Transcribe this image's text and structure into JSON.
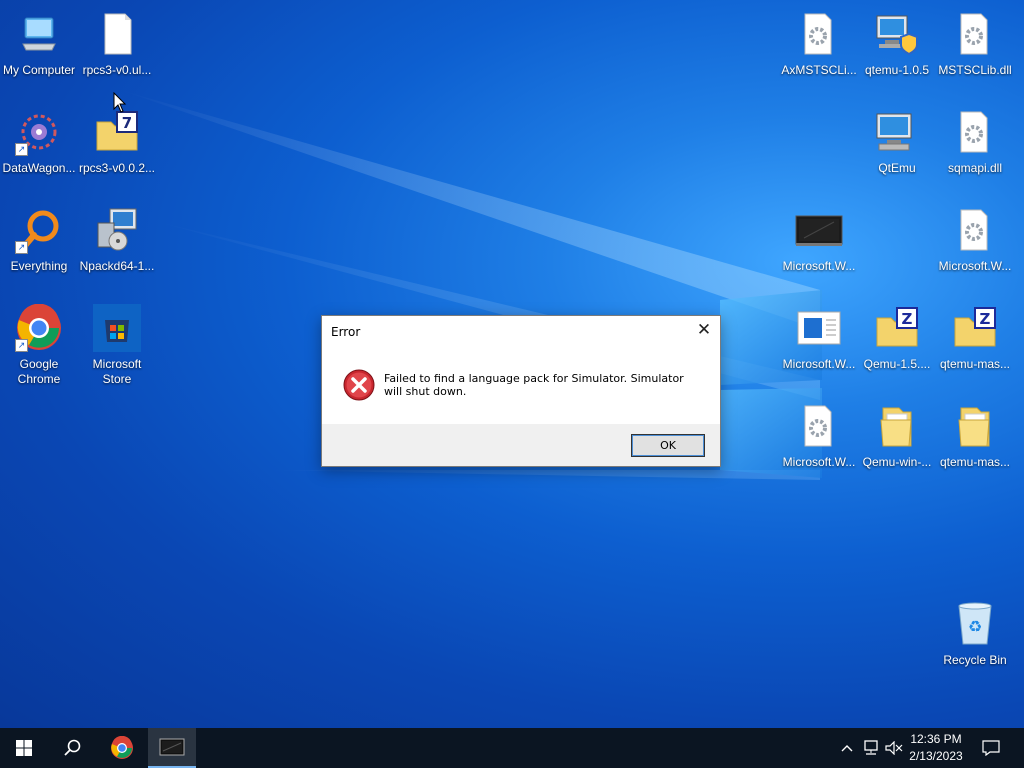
{
  "desktop": {
    "left_icons": [
      {
        "label": "My Computer",
        "icon": "computer-icon"
      },
      {
        "label": "rpcs3-v0.ul...",
        "icon": "file-icon"
      },
      {
        "label": "DataWagon...",
        "icon": "datawagon-icon"
      },
      {
        "label": "rpcs3-v0.0.2...",
        "icon": "archive-icon"
      },
      {
        "label": "Everything",
        "icon": "search-magnifier-icon"
      },
      {
        "label": "Npackd64-1...",
        "icon": "installer-icon"
      },
      {
        "label": "Google Chrome",
        "icon": "chrome-icon"
      },
      {
        "label": "Microsoft Store",
        "icon": "store-icon"
      }
    ],
    "right_icons": [
      {
        "label": "AxMSTSCLi...",
        "icon": "dll-icon"
      },
      {
        "label": "qtemu-1.0.5",
        "icon": "setup-icon"
      },
      {
        "label": "MSTSCLib.dll",
        "icon": "dll-icon"
      },
      {
        "label": "QtEmu",
        "icon": "computer-icon"
      },
      {
        "label": "sqmapi.dll",
        "icon": "dll-icon"
      },
      {
        "label": "Microsoft.W...",
        "icon": "monitor-icon"
      },
      {
        "label": "Microsoft.W...",
        "icon": "dll-icon"
      },
      {
        "label": "Microsoft.W...",
        "icon": "document-icon"
      },
      {
        "label": "Qemu-1.5....",
        "icon": "zip-folder-icon"
      },
      {
        "label": "qtemu-mas...",
        "icon": "zip-folder-icon"
      },
      {
        "label": "Microsoft.W...",
        "icon": "dll-icon"
      },
      {
        "label": "Qemu-win-...",
        "icon": "folder-icon"
      },
      {
        "label": "qtemu-mas...",
        "icon": "folder-icon"
      },
      {
        "label": "Recycle Bin",
        "icon": "recycle-bin-icon"
      }
    ]
  },
  "dialog": {
    "title": "Error",
    "message": "Failed to find a language pack for Simulator. Simulator will shut down.",
    "ok_label": "OK",
    "close_glyph": "✕"
  },
  "taskbar": {
    "pinned": [
      "start-icon",
      "search-icon",
      "chrome-icon",
      "terminal-icon"
    ],
    "clock_time": "12:36 PM",
    "clock_date": "2/13/2023"
  }
}
